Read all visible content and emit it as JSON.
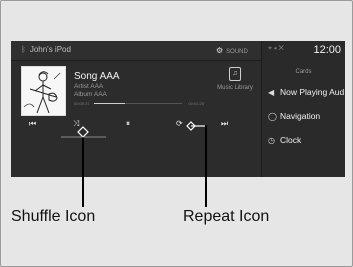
{
  "media": {
    "source_icon": "bluetooth-icon",
    "source": "John's iPod",
    "sound_icon": "gear-icon",
    "sound_label": "SOUND",
    "song": "Song AAA",
    "artist": "Artist AAA",
    "album": "Album AAA",
    "elapsed": "00:00:37",
    "total": "00:01:25",
    "library_label": "Music Library"
  },
  "controls": {
    "prev": "⏮",
    "shuffle": "⤨",
    "pause": "⏸",
    "repeat": "⟳",
    "next": "⏭"
  },
  "side": {
    "status": "⌖ ◂ ✕",
    "clock": "12:00",
    "cards_label": "Cards",
    "items": [
      {
        "icon": "speaker-icon",
        "glyph": "◀",
        "label": "Now Playing Aud"
      },
      {
        "icon": "navigation-icon",
        "glyph": "◯",
        "label": "Navigation"
      },
      {
        "icon": "clock-icon",
        "glyph": "◷",
        "label": "Clock"
      }
    ]
  },
  "callouts": {
    "shuffle": "Shuffle Icon",
    "repeat": "Repeat Icon"
  }
}
